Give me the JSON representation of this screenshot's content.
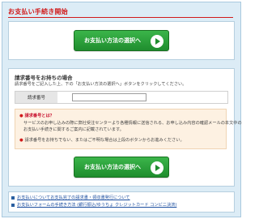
{
  "page": {
    "title": "お支払い手続き開始"
  },
  "cta": {
    "label": "お支払い方法の選択へ"
  },
  "billing_section": {
    "heading": "請求番号をお持ちの場合",
    "description": "請求番号をご記入した上、下の「お支払い方法の選択へ」ボタンをクリックしてください。",
    "field_label": "請求番号",
    "field_value": "",
    "field_placeholder": ""
  },
  "note": {
    "heading": "請求番号とは？",
    "body_line1": "サービスのお申し込みの際に弊社受注センターより各種情報に送信される、お申し込み内容の確認メールの本文中の",
    "body_line2": "お支払い手続きに関するご案内に記載されています。",
    "body_line3": "請求番号をお持ちでない、またはご不明な場合は上段のボタンからお進みください。"
  },
  "links": [
    {
      "text": "お支払いについてお支払完了の請求書・領収書発行について"
    },
    {
      "text": "お支払いフォームの手続き方法 (銀行振込/ゆうちょ クレジットカード コンビニ決済)"
    }
  ]
}
